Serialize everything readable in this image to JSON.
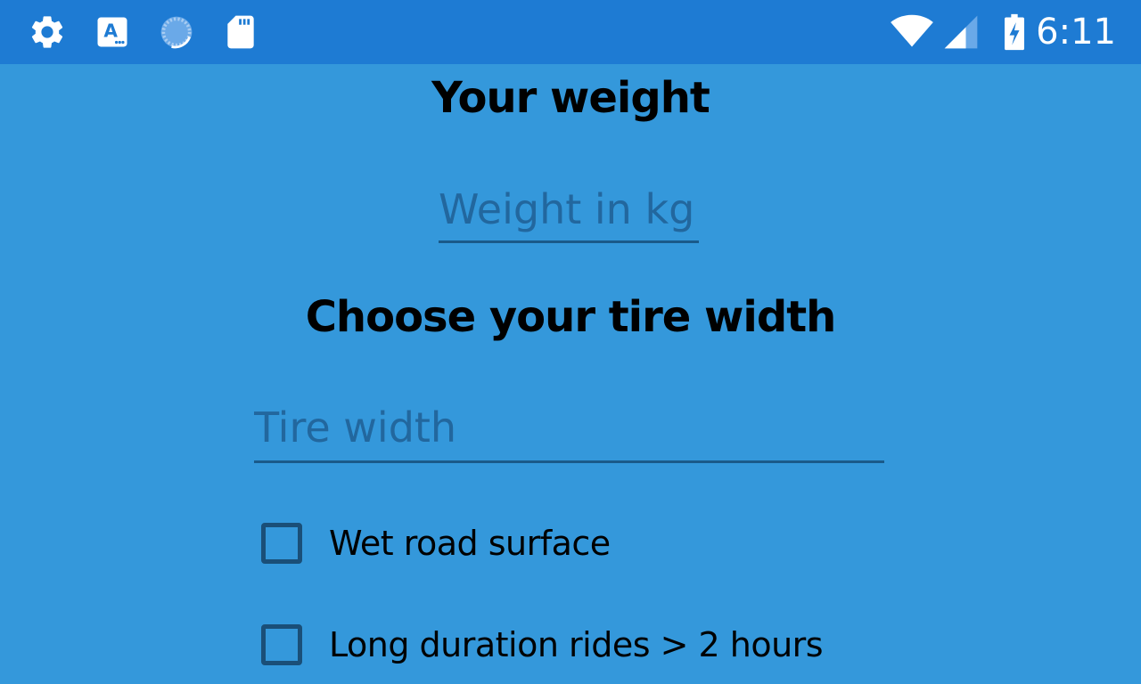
{
  "status_bar": {
    "left_icons": [
      "settings-gear-icon",
      "keyboard-a-icon",
      "sync-loading-icon",
      "sd-card-icon"
    ],
    "right_icons": [
      "wifi-icon",
      "cellular-signal-icon",
      "battery-charging-icon"
    ],
    "time": "6:11",
    "background_color": "#1e7bd3"
  },
  "form": {
    "background_color": "#3498db",
    "weight_heading": "Your weight",
    "weight_input": {
      "value": "",
      "placeholder": "Weight in kg"
    },
    "tire_heading": "Choose your tire width",
    "tire_input": {
      "value": "",
      "placeholder": "Tire width"
    },
    "checkboxes": [
      {
        "label": "Wet road surface",
        "checked": false
      },
      {
        "label": "Long duration rides > 2 hours",
        "checked": false
      }
    ]
  }
}
